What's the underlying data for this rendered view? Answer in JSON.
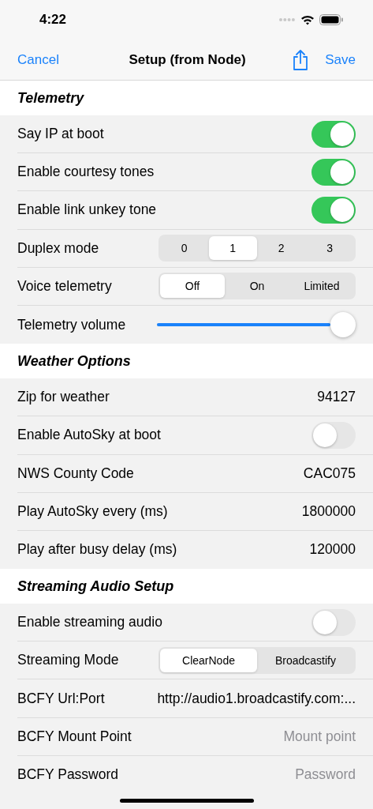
{
  "status_bar": {
    "time": "4:22"
  },
  "nav": {
    "cancel": "Cancel",
    "title": "Setup (from Node)",
    "save": "Save"
  },
  "sections": [
    {
      "title": "Telemetry",
      "rows": [
        {
          "kind": "toggle",
          "label": "Say IP at boot",
          "on": true
        },
        {
          "kind": "toggle",
          "label": "Enable courtesy tones",
          "on": true
        },
        {
          "kind": "toggle",
          "label": "Enable link unkey tone",
          "on": true
        },
        {
          "kind": "segmented",
          "label": "Duplex mode",
          "segments": [
            {
              "label": "0",
              "selected": false
            },
            {
              "label": "1",
              "selected": true
            },
            {
              "label": "2",
              "selected": false
            },
            {
              "label": "3",
              "selected": false
            }
          ]
        },
        {
          "kind": "segmented",
          "label": "Voice telemetry",
          "segments": [
            {
              "label": "Off",
              "selected": true
            },
            {
              "label": "On",
              "selected": false
            },
            {
              "label": "Limited",
              "selected": false
            }
          ]
        },
        {
          "kind": "slider",
          "label": "Telemetry volume",
          "level": 1
        }
      ]
    },
    {
      "title": "Weather Options",
      "rows": [
        {
          "kind": "value",
          "label": "Zip for weather",
          "value": "94127"
        },
        {
          "kind": "toggle",
          "label": "Enable AutoSky at boot",
          "on": false
        },
        {
          "kind": "value",
          "label": "NWS County Code",
          "value": "CAC075"
        },
        {
          "kind": "value",
          "label": "Play AutoSky every (ms)",
          "value": "1800000"
        },
        {
          "kind": "value",
          "label": "Play after busy delay (ms)",
          "value": "120000"
        }
      ]
    },
    {
      "title": "Streaming Audio Setup",
      "rows": [
        {
          "kind": "toggle",
          "label": "Enable streaming audio",
          "on": false
        },
        {
          "kind": "segmented",
          "label": "Streaming Mode",
          "segments": [
            {
              "label": "ClearNode",
              "selected": true
            },
            {
              "label": "Broadcastify",
              "selected": false
            }
          ]
        },
        {
          "kind": "value",
          "label": "BCFY Url:Port",
          "value": "http://audio1.broadcastify.com:..."
        },
        {
          "kind": "field",
          "label": "BCFY Mount Point",
          "placeholder": "Mount point"
        },
        {
          "kind": "field",
          "label": "BCFY Password",
          "placeholder": "Password"
        }
      ]
    }
  ]
}
